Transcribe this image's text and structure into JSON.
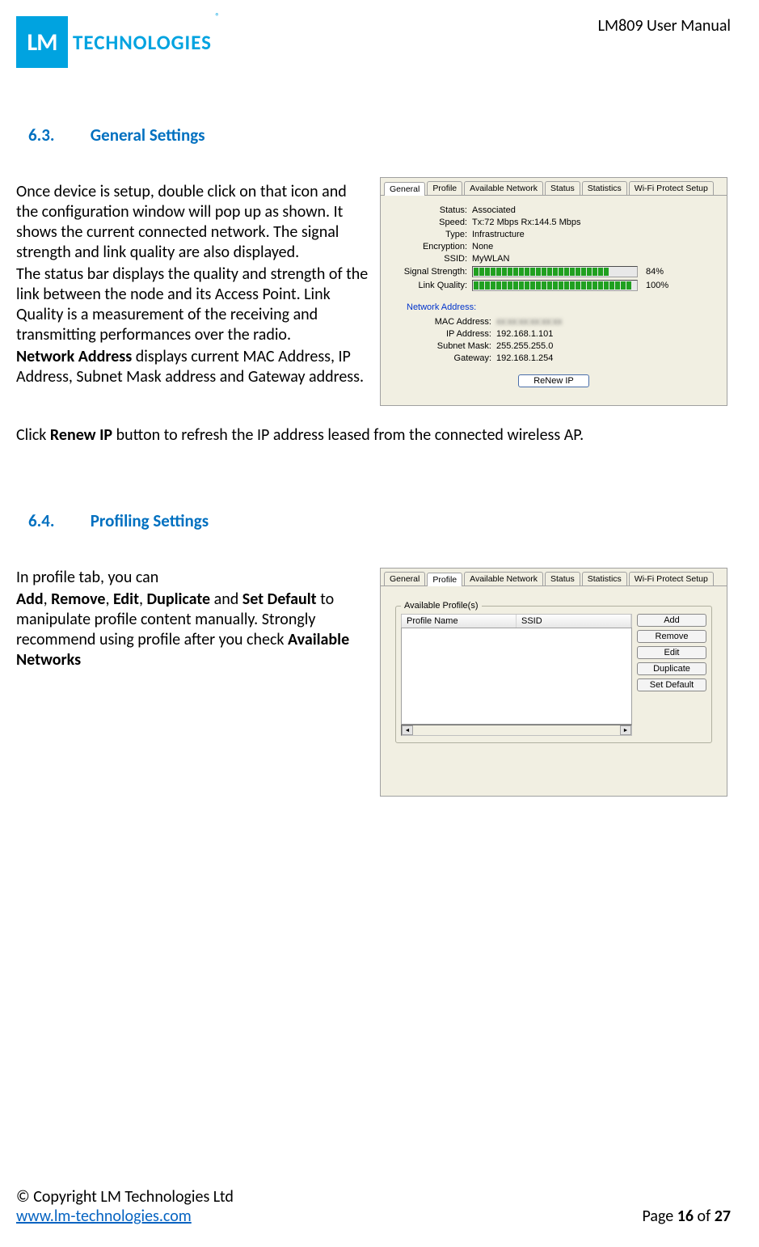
{
  "header": {
    "logo_mark": "LM",
    "logo_word": "TECHNOLOGIES",
    "logo_reg": "®",
    "doc_title": "LM809 User Manual"
  },
  "section63": {
    "num": "6.3.",
    "title": "General Settings",
    "para1": "Once device is setup, double click on that icon and the configuration window will pop up as shown. It shows the current connected network. The signal strength and link quality are also displayed.",
    "para2": "The status bar displays the quality and strength of the link between the node and its Access Point. Link Quality is a measurement of the receiving and transmitting performances over the radio.",
    "para3_bold": "Network Address",
    "para3_rest": " displays current MAC Address, IP Address, Subnet Mask address and Gateway address.",
    "para4_pre": "Click ",
    "para4_bold": "Renew IP",
    "para4_post": " button to refresh the IP address leased from the connected wireless AP."
  },
  "general_panel": {
    "tabs": [
      "General",
      "Profile",
      "Available Network",
      "Status",
      "Statistics",
      "Wi-Fi Protect Setup"
    ],
    "active_tab": 0,
    "status_label": "Status:",
    "status": "Associated",
    "speed_label": "Speed:",
    "speed": "Tx:72 Mbps Rx:144.5 Mbps",
    "type_label": "Type:",
    "type": "Infrastructure",
    "encryption_label": "Encryption:",
    "encryption": "None",
    "ssid_label": "SSID:",
    "ssid": "MyWLAN",
    "signal_label": "Signal Strength:",
    "signal_pct": "84%",
    "link_label": "Link Quality:",
    "link_pct": "100%",
    "networkaddr_title": "Network Address:",
    "mac_label": "MAC Address:",
    "mac": "xx:xx:xx:xx:xx:xx",
    "ip_label": "IP Address:",
    "ip": "192.168.1.101",
    "subnet_label": "Subnet Mask:",
    "subnet": "255.255.255.0",
    "gateway_label": "Gateway:",
    "gateway": "192.168.1.254",
    "renew_btn": "ReNew IP"
  },
  "section64": {
    "num": "6.4.",
    "title": "Profiling Settings",
    "intro": "In profile tab, you can",
    "b1": "Add",
    "c1": ", ",
    "b2": "Remove",
    "c2": ", ",
    "b3": "Edit",
    "c3": ", ",
    "b4": "Duplicate",
    "c4": " and ",
    "b5": "Set Default",
    "rest": " to manipulate profile content manually. Strongly recommend using profile after you check ",
    "b6": "Available Networks"
  },
  "profile_panel": {
    "tabs": [
      "General",
      "Profile",
      "Available Network",
      "Status",
      "Statistics",
      "Wi-Fi Protect Setup"
    ],
    "active_tab": 1,
    "legend": "Available Profile(s)",
    "col0": "Profile Name",
    "col1": "SSID",
    "buttons": [
      "Add",
      "Remove",
      "Edit",
      "Duplicate",
      "Set Default"
    ]
  },
  "footer": {
    "copyright": "© Copyright LM Technologies Ltd",
    "url": "www.lm-technologies.com",
    "page_pre": "Page ",
    "page_cur": "16",
    "page_mid": " of ",
    "page_total": "27"
  }
}
